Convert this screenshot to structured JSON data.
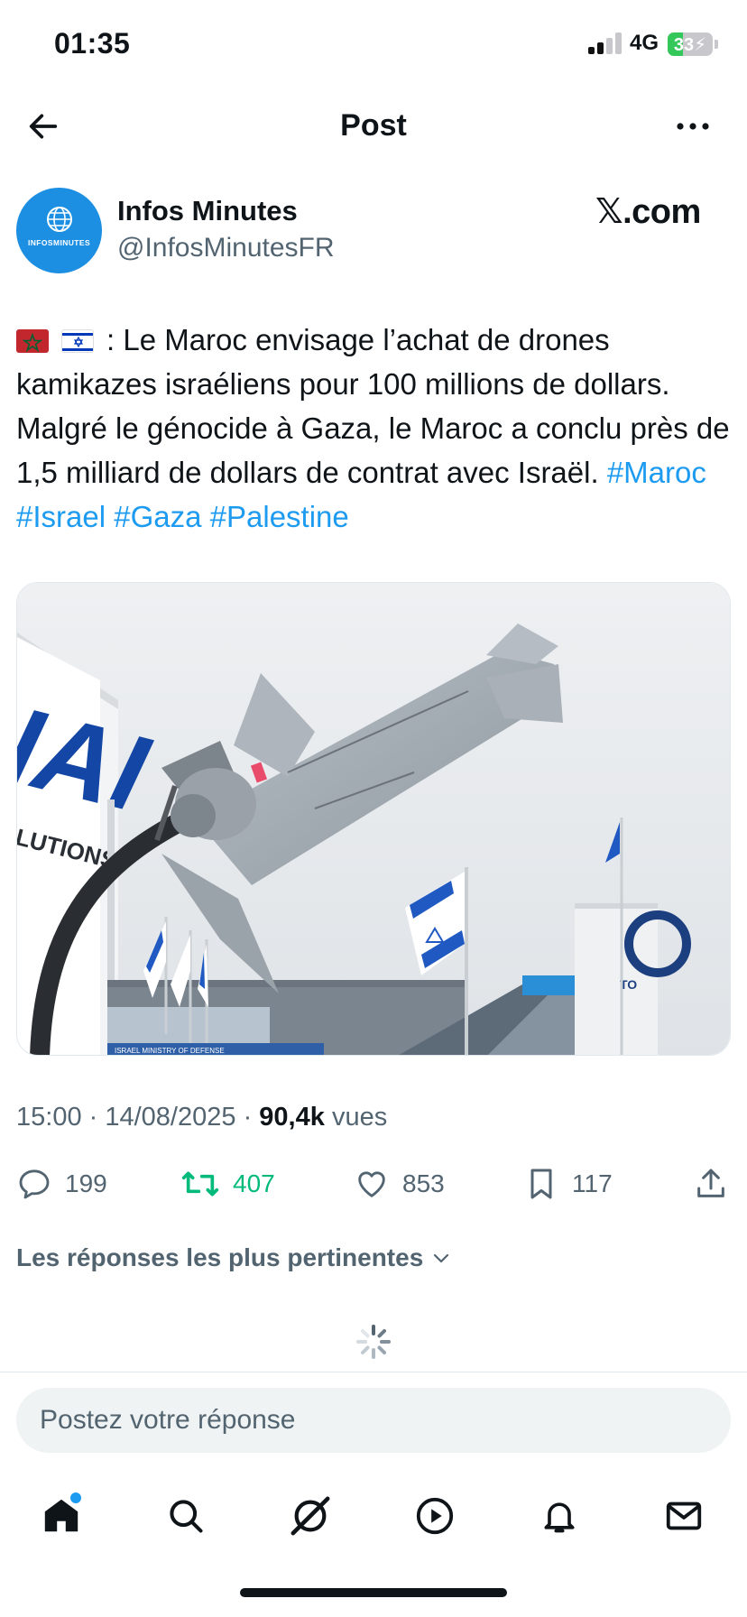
{
  "status_bar": {
    "time": "01:35",
    "network": "4G",
    "battery": "33",
    "battery_level": 0.33,
    "colors": {
      "battery_fill": "#34c759"
    }
  },
  "nav": {
    "title": "Post",
    "back_icon": "arrow-left-icon",
    "more_icon": "more-horizontal-icon"
  },
  "author": {
    "name": "Infos Minutes",
    "handle": "@InfosMinutesFR",
    "avatar_text": "INFOSMINUTES",
    "brand": "𝕏.com"
  },
  "post": {
    "flags": [
      "🇲🇦",
      "🇮🇱"
    ],
    "text_main": ": Le Maroc envisage l’achat de drones kamikazes israéliens pour 100 millions de dollars. Malgré le génocide à Gaza, le Maroc a conclu près de 1,5 milliard de dollars de contrat avec Israël.",
    "hashtags": [
      "#Maroc",
      "#Israel",
      "#Gaza",
      "#Palestine"
    ],
    "image_logo_text": "IAI",
    "image_side_text": "LUTIONS",
    "image_banner_text": "ISRAEL MINISTRY OF DEFENSE",
    "image_right_text": "TO",
    "time": "15:00",
    "date": "14/08/2025",
    "views_count": "90,4k",
    "views_label": "vues"
  },
  "actions": {
    "replies": "199",
    "reposts": "407",
    "likes": "853",
    "bookmarks": "117",
    "colors": {
      "repost": "#00ba7c",
      "default": "#536471",
      "link": "#1d9bf0"
    }
  },
  "replies_sort": {
    "label": "Les réponses les plus pertinentes"
  },
  "reply_box": {
    "placeholder": "Postez votre réponse"
  },
  "tabbar": {
    "items": [
      "home-icon",
      "search-icon",
      "grok-icon",
      "video-icon",
      "notifications-icon",
      "messages-icon"
    ]
  }
}
